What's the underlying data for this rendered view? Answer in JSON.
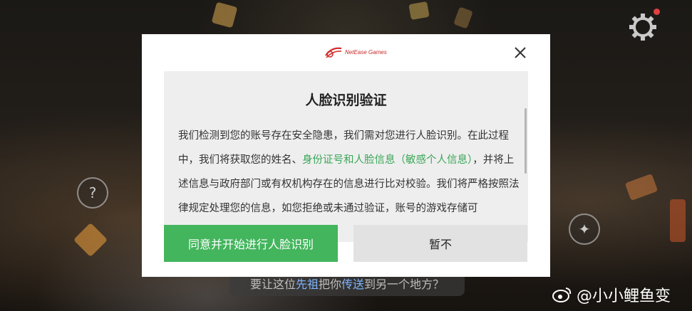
{
  "brand": {
    "logo_text": "NetEase Games"
  },
  "dialog": {
    "title": "人脸识别验证",
    "body": {
      "part1": "我们检测到您的账号存在安全隐患，我们需对您进行人脸识别。在此过程中，我们将获取您的姓名、",
      "highlight": "身份证号和人脸信息（敏感个人信息）",
      "part2": "，并将上述信息与政府部门或有权机构存在的信息进行比对校验。我们将严格按照法律规定处理您的信息，如您拒绝或未通过验证，账号的游戏存储可"
    },
    "agree_label": "同意并开始进行人脸识别",
    "later_label": "暂不",
    "close_icon": "close-icon"
  },
  "game": {
    "caption_part1": "要让这位",
    "caption_hl1": "先祖",
    "caption_part2": "把你",
    "caption_hl2": "传送",
    "caption_part3": "到另一个地方？",
    "settings_icon": "gear-icon"
  },
  "watermark": {
    "text": "@小小鲤鱼变"
  },
  "colors": {
    "accent_green": "#43b55d",
    "highlight_green": "#3aa657"
  }
}
